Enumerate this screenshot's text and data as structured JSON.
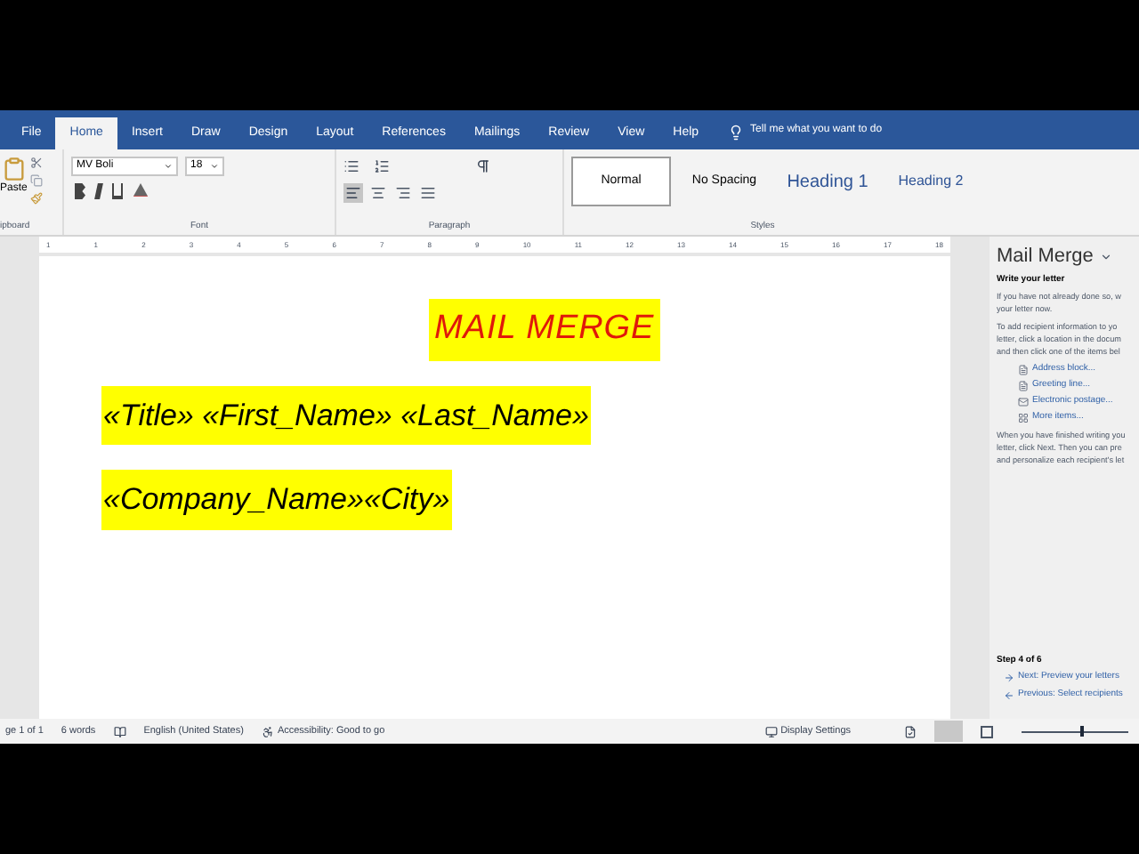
{
  "tabs": [
    {
      "label": "File",
      "selected": false
    },
    {
      "label": "Home",
      "selected": true
    },
    {
      "label": "Insert",
      "selected": false
    },
    {
      "label": "Draw",
      "selected": false
    },
    {
      "label": "Design",
      "selected": false
    },
    {
      "label": "Layout",
      "selected": false
    },
    {
      "label": "References",
      "selected": false
    },
    {
      "label": "Mailings",
      "selected": false
    },
    {
      "label": "Review",
      "selected": false
    },
    {
      "label": "View",
      "selected": false
    },
    {
      "label": "Help",
      "selected": false
    }
  ],
  "tell_me": "Tell me what you want to do",
  "clipboard": {
    "paste": "Paste",
    "label": "ipboard"
  },
  "font": {
    "name": "MV Boli",
    "size": "18",
    "label": "Font"
  },
  "paragraph": {
    "label": "Paragraph",
    "alignments": [
      {
        "selected": true
      },
      {
        "selected": false
      },
      {
        "selected": false
      },
      {
        "selected": false
      }
    ]
  },
  "styles": {
    "label": "Styles",
    "items": [
      {
        "label": "Normal",
        "selected": true,
        "kind": "normal"
      },
      {
        "label": "No Spacing",
        "selected": false,
        "kind": "normal"
      },
      {
        "label": "Heading 1",
        "selected": false,
        "kind": "heading1"
      },
      {
        "label": "Heading 2",
        "selected": false,
        "kind": "heading2"
      }
    ]
  },
  "ruler": [
    "1",
    "1",
    "2",
    "3",
    "4",
    "5",
    "6",
    "7",
    "8",
    "9",
    "10",
    "11",
    "12",
    "13",
    "14",
    "15",
    "16",
    "17",
    "18"
  ],
  "document": {
    "title": "MAIL MERGE",
    "lines": [
      "«Title» «First_Name» «Last_Name»",
      "«Company_Name»«City»"
    ]
  },
  "pane": {
    "title": "Mail Merge",
    "heading": "Write your letter",
    "intro": [
      "If you have not already done so, w",
      "your letter now."
    ],
    "instructions": [
      "To add recipient information to yo",
      "letter, click a location in the docum",
      "and then click one of the items bel"
    ],
    "links": [
      {
        "label": "Address block...",
        "kind": "address"
      },
      {
        "label": "Greeting line...",
        "kind": "greeting"
      },
      {
        "label": "Electronic postage...",
        "kind": "postage"
      },
      {
        "label": "More items...",
        "kind": "more"
      }
    ],
    "finish": [
      "When you have finished writing you",
      "letter, click Next. Then you can pre",
      "and personalize each recipient's let"
    ],
    "step": "Step 4 of 6",
    "next": "Next: Preview your letters",
    "previous": "Previous: Select recipients"
  },
  "status_bar": {
    "page": "ge 1 of 1",
    "words": "6 words",
    "language": "English (United States)",
    "accessibility": "Accessibility: Good to go",
    "display": "Display Settings",
    "zoom": {
      "level": 0.55
    }
  }
}
